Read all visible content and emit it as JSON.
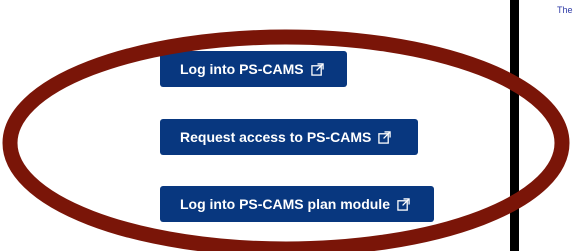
{
  "buttons": {
    "login": "Log into PS-CAMS",
    "request_access": "Request access to PS-CAMS",
    "plan_module": "Log into PS-CAMS plan module"
  },
  "side_panel": {
    "text": "The"
  },
  "colors": {
    "button_bg": "#08377f",
    "annotation_ring": "#7a1508",
    "divider": "#000000"
  },
  "icons": {
    "external_link": "external-link-icon"
  }
}
